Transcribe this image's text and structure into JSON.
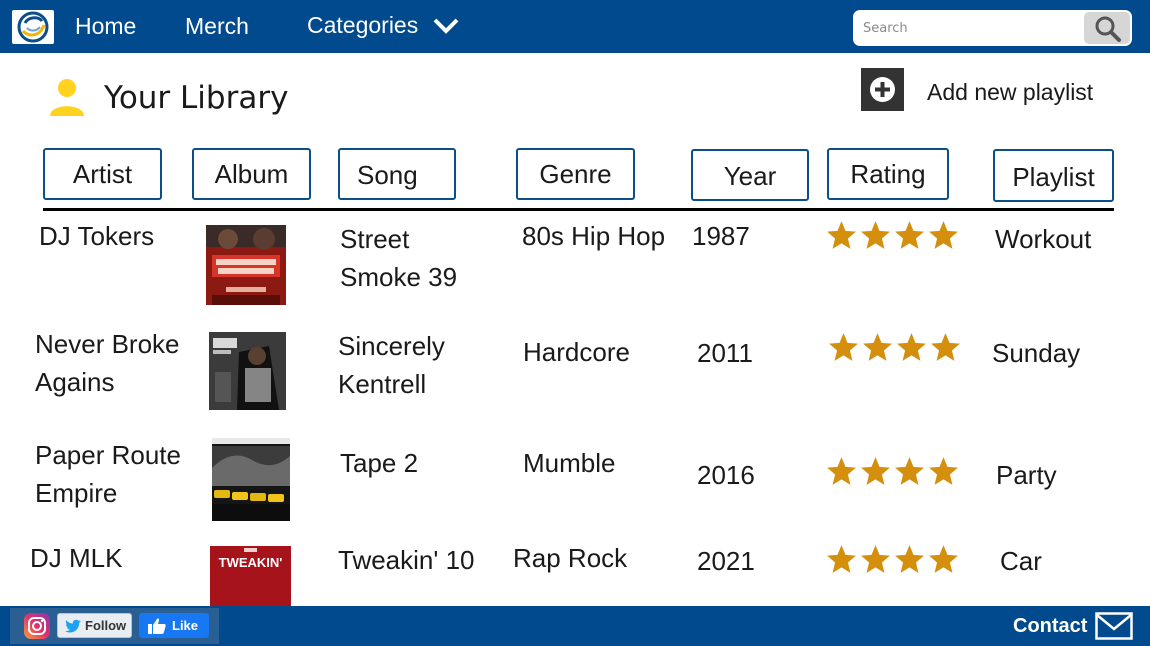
{
  "nav": {
    "logo_icon": "logo-icon",
    "home": "Home",
    "merch": "Merch",
    "categories": "Categories",
    "search_placeholder": "Search",
    "colors": {
      "bar": "#004a8d"
    }
  },
  "library": {
    "title": "Your Library",
    "add_playlist": "Add new playlist"
  },
  "columns": {
    "artist": "Artist",
    "album": "Album",
    "song": "Song",
    "genre": "Genre",
    "year": "Year",
    "rating": "Rating",
    "playlist": "Playlist"
  },
  "rows": [
    {
      "artist": [
        "DJ Tokers"
      ],
      "album_art": "street-smoke-cover",
      "song": [
        "Street",
        "Smoke 39"
      ],
      "genre": "80s Hip Hop",
      "year": "1987",
      "rating": 4,
      "playlist": "Workout"
    },
    {
      "artist": [
        "Never Broke",
        "Agains"
      ],
      "album_art": "sincerely-cover",
      "song": [
        "Sincerely",
        "Kentrell"
      ],
      "genre": "Hardcore",
      "year": "2011",
      "rating": 4,
      "playlist": "Sunday"
    },
    {
      "artist": [
        "Paper Route",
        "Empire"
      ],
      "album_art": "tape2-cover",
      "song": [
        "Tape 2"
      ],
      "genre": "Mumble",
      "year": "2016",
      "rating": 4,
      "playlist": "Party"
    },
    {
      "artist": [
        "DJ MLK"
      ],
      "album_art": "tweakin-cover",
      "song": [
        "Tweakin' 10"
      ],
      "genre": "Rap Rock",
      "year": "2021",
      "rating": 4,
      "playlist": "Car"
    }
  ],
  "album_text": {
    "tweakin": "TWEAKIN'"
  },
  "footer": {
    "follow": "Follow",
    "like": "Like",
    "contact": "Contact"
  },
  "star_color": "#d4900c"
}
